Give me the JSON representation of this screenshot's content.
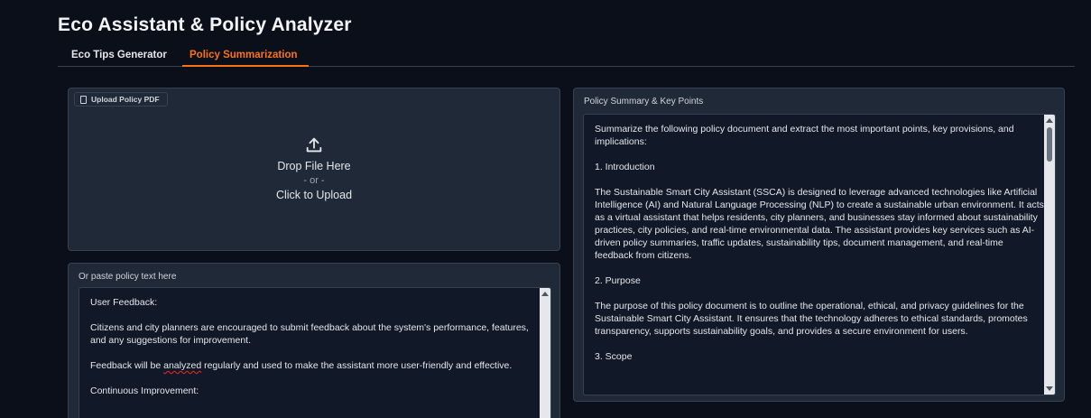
{
  "app": {
    "title": "Eco Assistant & Policy Analyzer"
  },
  "tabs": [
    {
      "label": "Eco Tips Generator",
      "active": false
    },
    {
      "label": "Policy Summarization",
      "active": true
    }
  ],
  "upload": {
    "label": "Upload Policy PDF",
    "drop_text": "Drop File Here",
    "or_text": "- or -",
    "click_text": "Click to Upload"
  },
  "paste": {
    "label": "Or paste policy text here",
    "paragraphs": [
      "User Feedback:",
      "Citizens and city planners are encouraged to submit feedback about the system's performance, features, and any suggestions for improvement.",
      "Feedback will be analyzed regularly and used to make the assistant more user-friendly and effective.",
      "Continuous Improvement:"
    ]
  },
  "summary": {
    "label": "Policy Summary & Key Points",
    "paragraphs": [
      "Summarize the following policy document and extract the most important points, key provisions, and implications:",
      "1. Introduction",
      "The Sustainable Smart City Assistant (SSCA) is designed to leverage advanced technologies like Artificial Intelligence (AI) and Natural Language Processing (NLP) to create a sustainable urban environment. It acts as a virtual assistant that helps residents, city planners, and businesses stay informed about sustainability practices, city policies, and real-time environmental data. The assistant provides key services such as AI-driven policy summaries, traffic updates, sustainability tips, document management, and real-time feedback from citizens.",
      "2. Purpose",
      "The purpose of this policy document is to outline the operational, ethical, and privacy guidelines for the Sustainable Smart City Assistant. It ensures that the technology adheres to ethical standards, promotes transparency, supports sustainability goals, and provides a secure environment for users.",
      "3. Scope"
    ]
  },
  "colors": {
    "accent": "#f97316",
    "background": "#0b0f19",
    "panel": "#1f2937",
    "input": "#111827"
  }
}
